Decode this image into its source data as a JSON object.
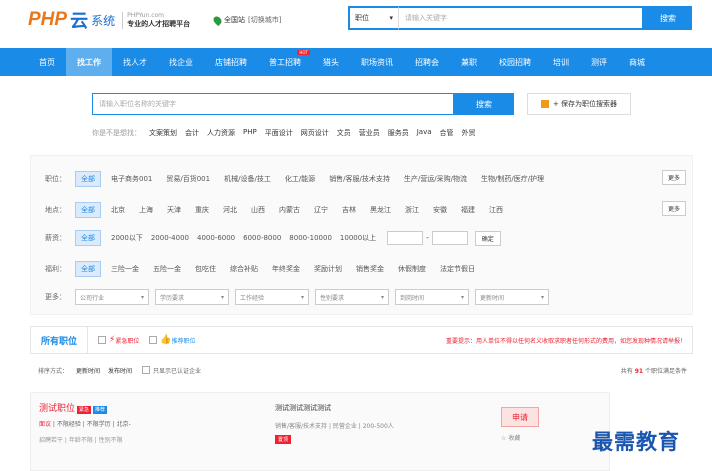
{
  "header": {
    "logo_php": "PHP",
    "logo_yun": "云",
    "logo_sys": "系统",
    "logo_url": "PHPYun.com",
    "logo_slogan": "专业的人才招聘平台",
    "city": "全国站",
    "city_switch": "[切换城市]"
  },
  "search": {
    "type": "职位",
    "placeholder": "请输入关键字",
    "button": "搜索"
  },
  "nav": {
    "items": [
      "首页",
      "找工作",
      "找人才",
      "找企业",
      "店铺招聘",
      "普工招聘",
      "猎头",
      "职场资讯",
      "招聘会",
      "兼职",
      "校园招聘",
      "培训",
      "测评",
      "商城"
    ],
    "hot_badge": "HOT"
  },
  "subsearch": {
    "placeholder": "请输入职位名称的关键字",
    "button": "搜索",
    "save_label": "+ 保存为职位搜索器"
  },
  "hotwords": {
    "label": "你是不是想找：",
    "words": [
      "文案策划",
      "会计",
      "人力资源",
      "PHP",
      "平面设计",
      "网页设计",
      "文员",
      "营业员",
      "服务员",
      "Java",
      "合管",
      "外贸"
    ]
  },
  "filters": {
    "job": {
      "label": "职位：",
      "all": "全部",
      "options": [
        "电子商务001",
        "贸易/百货001",
        "机械/设备/技工",
        "化工/能源",
        "销售/客服/技术支持",
        "生产/营运/采购/物流",
        "生物/制药/医疗/护理"
      ],
      "more": "更多"
    },
    "location": {
      "label": "地点：",
      "all": "全部",
      "options": [
        "北京",
        "上海",
        "天津",
        "重庆",
        "河北",
        "山西",
        "内蒙古",
        "辽宁",
        "吉林",
        "黑龙江",
        "浙江",
        "安徽",
        "福建",
        "江西"
      ],
      "more": "更多"
    },
    "salary": {
      "label": "薪资：",
      "all": "全部",
      "options": [
        "2000以下",
        "2000-4000",
        "4000-6000",
        "6000-8000",
        "8000-10000",
        "10000以上"
      ],
      "dash": "-",
      "ok": "确定"
    },
    "welfare": {
      "label": "福利：",
      "all": "全部",
      "options": [
        "三险一金",
        "五险一金",
        "包吃住",
        "综合补贴",
        "年终奖金",
        "奖励计划",
        "销售奖金",
        "休假制度",
        "法定节假日"
      ]
    },
    "more": {
      "label": "更多：",
      "selects": [
        "公司行业",
        "学历要求",
        "工作经验",
        "性别要求",
        "到岗时间",
        "更新时间"
      ]
    }
  },
  "tabs": {
    "all": "所有职位",
    "urgent": "紧急职位",
    "recommend": "推荐职位",
    "tip": "重要提示：用人单位不得以任何名义收取求职者任何形式的费用，如您发现种情况请举报！"
  },
  "sortbar": {
    "label": "排序方式：",
    "update": "更新时间",
    "publish": "发布时间",
    "verified": "只显示已认证企业",
    "count_pre": "共有",
    "count": "91",
    "count_post": "个职位满足条件"
  },
  "listing": {
    "title": "测试职位",
    "badge_urgent": "紧急",
    "badge_rec": "推荐",
    "salary": "面议",
    "exp": "不限经验",
    "edu": "不限学历",
    "loc": "北京-",
    "meta2": "招聘若干 | 年龄不限 | 性别不限",
    "company": "测试测试测试测试",
    "company_info": "销售/客服/技术支持 | 民营企业 | 200-500人",
    "company_tag": "置顶",
    "apply": "申请",
    "collect": "收藏"
  },
  "watermark": "最需教育",
  "colors": {
    "primary": "#1a8be6",
    "accent": "#e23",
    "logo_orange": "#e9781a"
  }
}
